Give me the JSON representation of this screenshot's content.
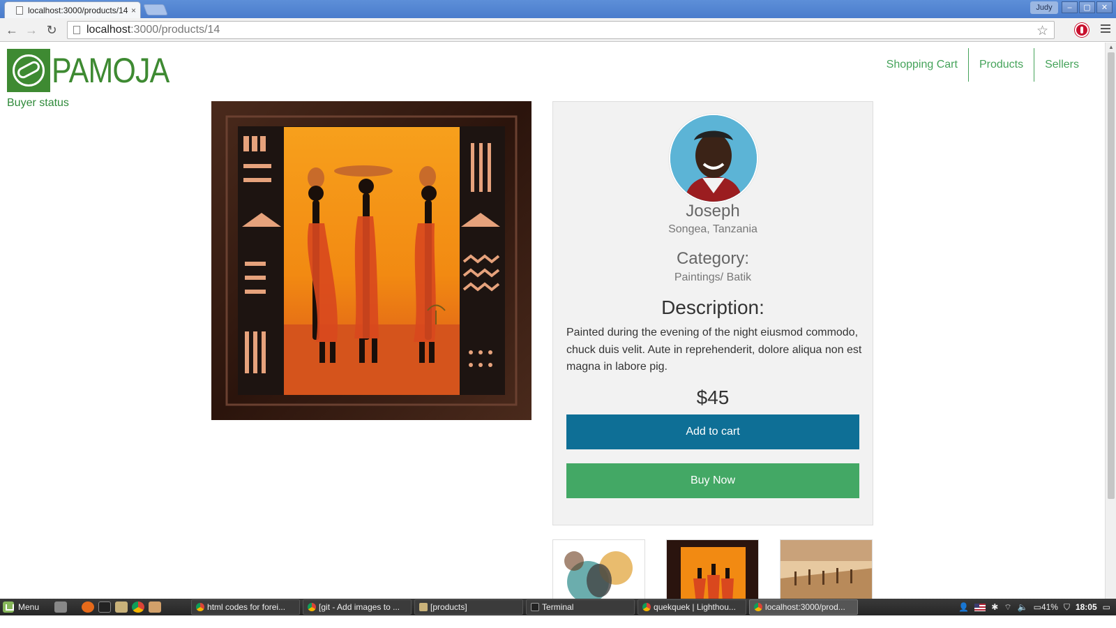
{
  "browser": {
    "tab_title": "localhost:3000/products/14",
    "tab_close": "×",
    "profile": "Judy",
    "url_host": "localhost",
    "url_path": ":3000/products/14",
    "win_min": "–",
    "win_max": "▢",
    "win_close": "✕"
  },
  "site": {
    "logo_text": "PAMOJA",
    "buyer_status": "Buyer status",
    "nav": [
      "Shopping Cart",
      "Products",
      "Sellers"
    ]
  },
  "product": {
    "seller_name": "Joseph",
    "seller_location": "Songea, Tanzania",
    "category_heading": "Category:",
    "category": "Paintings/ Batik",
    "description_heading": "Description:",
    "description": "Painted during the evening of the night eiusmod commodo, chuck duis velit. Aute in reprehenderit, dolore aliqua non est magna in labore pig.",
    "price": "$45",
    "add_to_cart": "Add to cart",
    "buy_now": "Buy Now"
  },
  "colors": {
    "brand_green": "#3e8a32",
    "nav_green": "#45a35a",
    "cart_button": "#0e6f96",
    "buy_button": "#43a865"
  },
  "taskbar": {
    "menu_label": "Menu",
    "tasks": [
      "html codes for forei...",
      "[git - Add images to ...",
      "[products]",
      "Terminal",
      "quekquek | Lighthou...",
      "localhost:3000/prod..."
    ],
    "battery": "41%",
    "clock": "18:05"
  }
}
